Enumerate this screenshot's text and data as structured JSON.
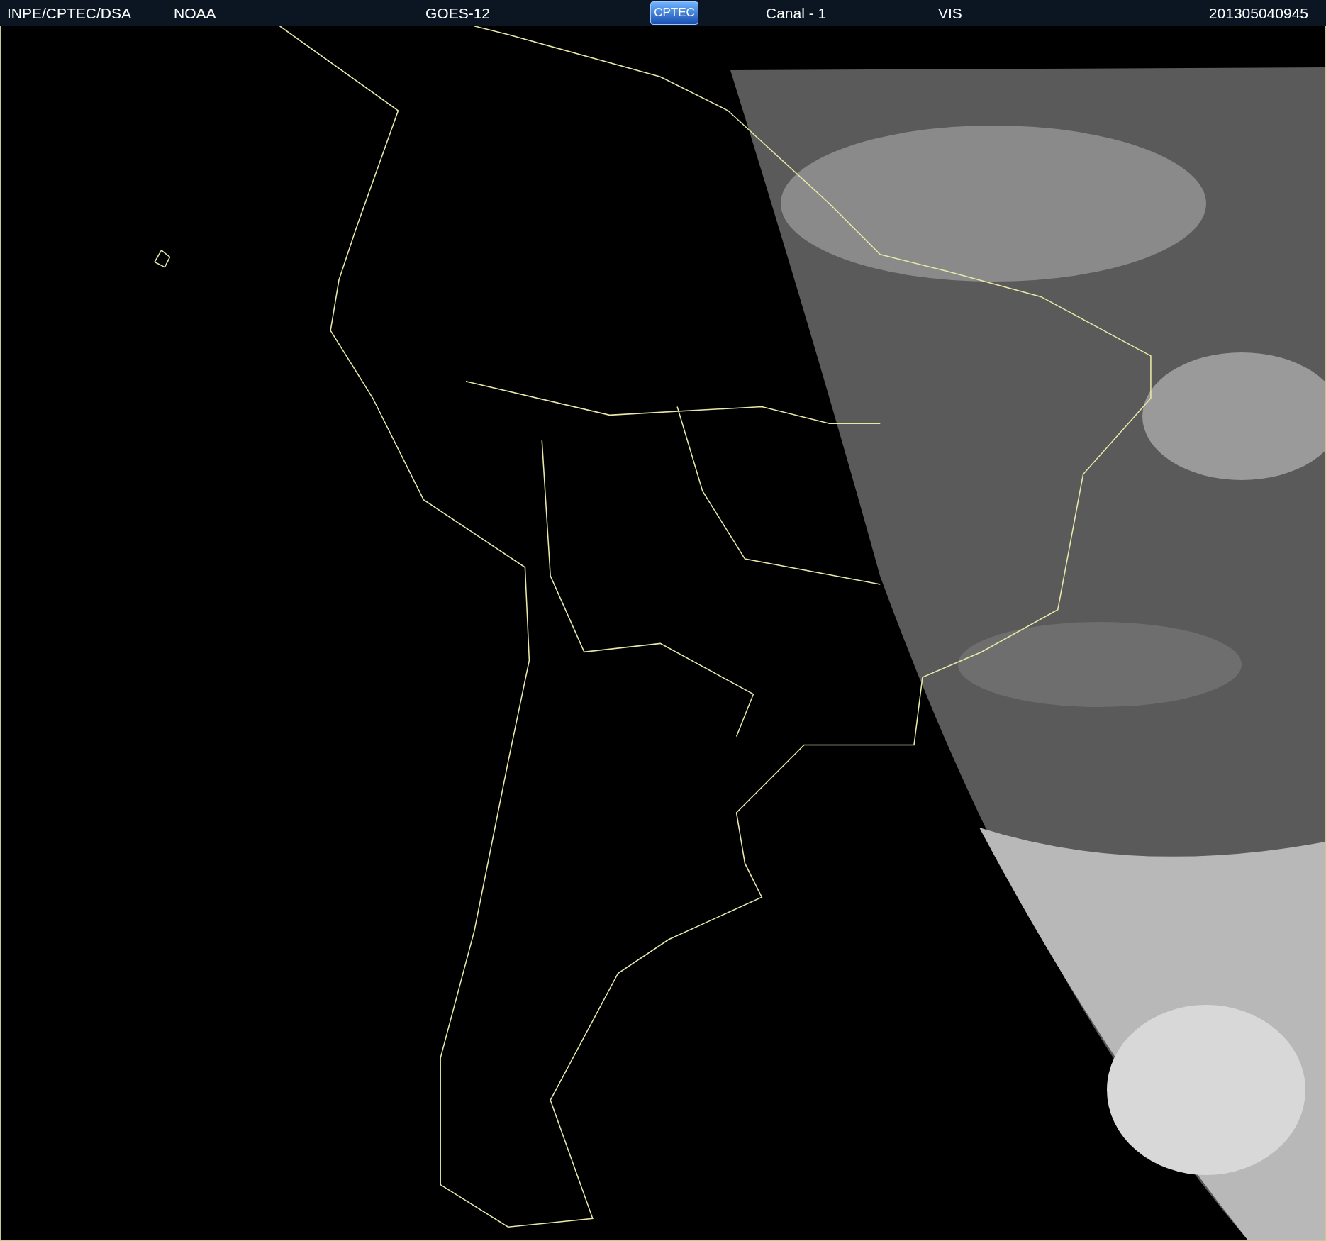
{
  "header": {
    "items": [
      {
        "kind": "text",
        "text": "INPE/CPTEC/DSA"
      },
      {
        "kind": "text",
        "text": "NOAA"
      },
      {
        "kind": "text",
        "text": "GOES-12"
      },
      {
        "kind": "logo",
        "text": "CPTEC"
      },
      {
        "kind": "text",
        "text": "Canal - 1"
      },
      {
        "kind": "text",
        "text": "VIS"
      },
      {
        "kind": "text",
        "text": "201305040945"
      }
    ]
  }
}
